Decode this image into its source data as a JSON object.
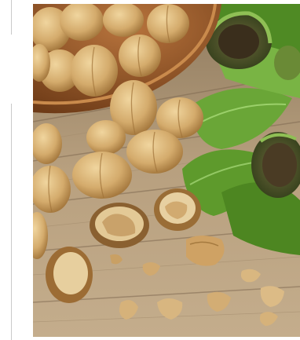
{
  "image": {
    "subject": "walnuts",
    "colors": {
      "wood": "#b49a78",
      "wood_dark": "#7a6249",
      "bowl": "#9b5a2c",
      "shell": "#d9b47a",
      "shell_shadow": "#a8793f",
      "kernel": "#e0c79a",
      "leaf": "#5f9a2e",
      "leaf_light": "#8ec45a",
      "husk": "#4a5a2a"
    }
  }
}
